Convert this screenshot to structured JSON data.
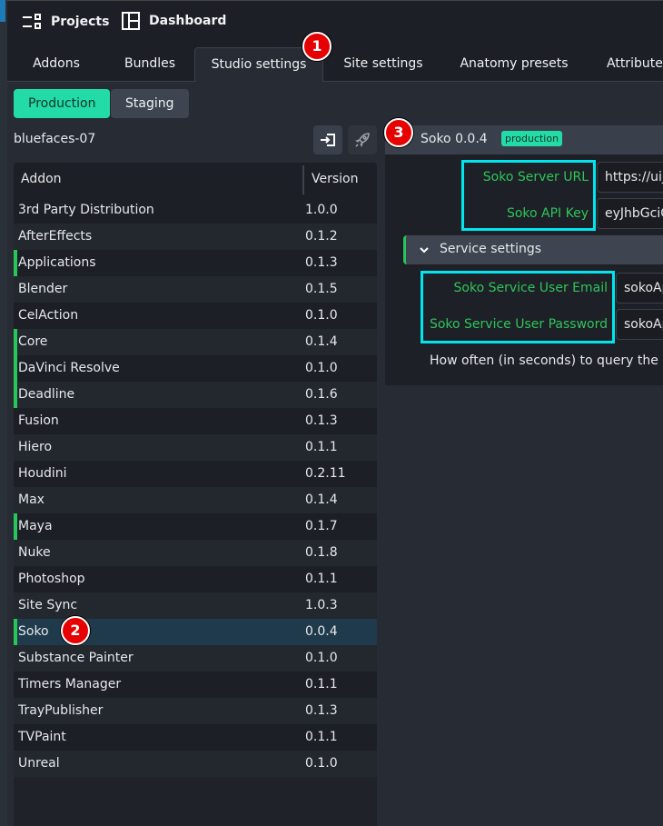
{
  "nav": {
    "projects": "Projects",
    "dashboard": "Dashboard"
  },
  "tabs": [
    "Addons",
    "Bundles",
    "Studio settings",
    "Site settings",
    "Anatomy presets",
    "Attributes"
  ],
  "active_tab": "Studio settings",
  "env": {
    "production": "Production",
    "staging": "Staging",
    "active": "Production"
  },
  "project": "bluefaces-07",
  "table": {
    "headers": [
      "Addon",
      "Version"
    ],
    "rows": [
      {
        "name": "3rd Party Distribution",
        "version": "1.0.0",
        "marked": false
      },
      {
        "name": "AfterEffects",
        "version": "0.1.2",
        "marked": false
      },
      {
        "name": "Applications",
        "version": "0.1.3",
        "marked": true
      },
      {
        "name": "Blender",
        "version": "0.1.5",
        "marked": false
      },
      {
        "name": "CelAction",
        "version": "0.1.0",
        "marked": false
      },
      {
        "name": "Core",
        "version": "0.1.4",
        "marked": true
      },
      {
        "name": "DaVinci Resolve",
        "version": "0.1.0",
        "marked": true
      },
      {
        "name": "Deadline",
        "version": "0.1.6",
        "marked": true
      },
      {
        "name": "Fusion",
        "version": "0.1.3",
        "marked": false
      },
      {
        "name": "Hiero",
        "version": "0.1.1",
        "marked": false
      },
      {
        "name": "Houdini",
        "version": "0.2.11",
        "marked": false
      },
      {
        "name": "Max",
        "version": "0.1.4",
        "marked": false
      },
      {
        "name": "Maya",
        "version": "0.1.7",
        "marked": true
      },
      {
        "name": "Nuke",
        "version": "0.1.8",
        "marked": false
      },
      {
        "name": "Photoshop",
        "version": "0.1.1",
        "marked": false
      },
      {
        "name": "Site Sync",
        "version": "1.0.3",
        "marked": false
      },
      {
        "name": "Soko",
        "version": "0.0.4",
        "marked": true,
        "selected": true
      },
      {
        "name": "Substance Painter",
        "version": "0.1.0",
        "marked": false
      },
      {
        "name": "Timers Manager",
        "version": "0.1.1",
        "marked": false
      },
      {
        "name": "TrayPublisher",
        "version": "0.1.3",
        "marked": false
      },
      {
        "name": "TVPaint",
        "version": "0.1.1",
        "marked": false
      },
      {
        "name": "Unreal",
        "version": "0.1.0",
        "marked": false
      }
    ]
  },
  "settings": {
    "title": "Soko 0.0.4",
    "badge": "production",
    "server_url_label": "Soko Server URL",
    "server_url_value": "https://uijr",
    "api_key_label": "Soko API Key",
    "api_key_value": "eyJhbGciO",
    "section": "Service settings",
    "email_label": "Soko Service User Email",
    "email_value": "sokoAp",
    "password_label": "Soko Service User Password",
    "password_value": "sokoAp",
    "query_label": "How often (in seconds) to query the So"
  },
  "annotations": [
    "1",
    "2",
    "3"
  ],
  "colors": {
    "accent": "#23dba6",
    "label_green": "#2fc55a",
    "highlight": "#00e5ee",
    "marker": "#e60000"
  }
}
